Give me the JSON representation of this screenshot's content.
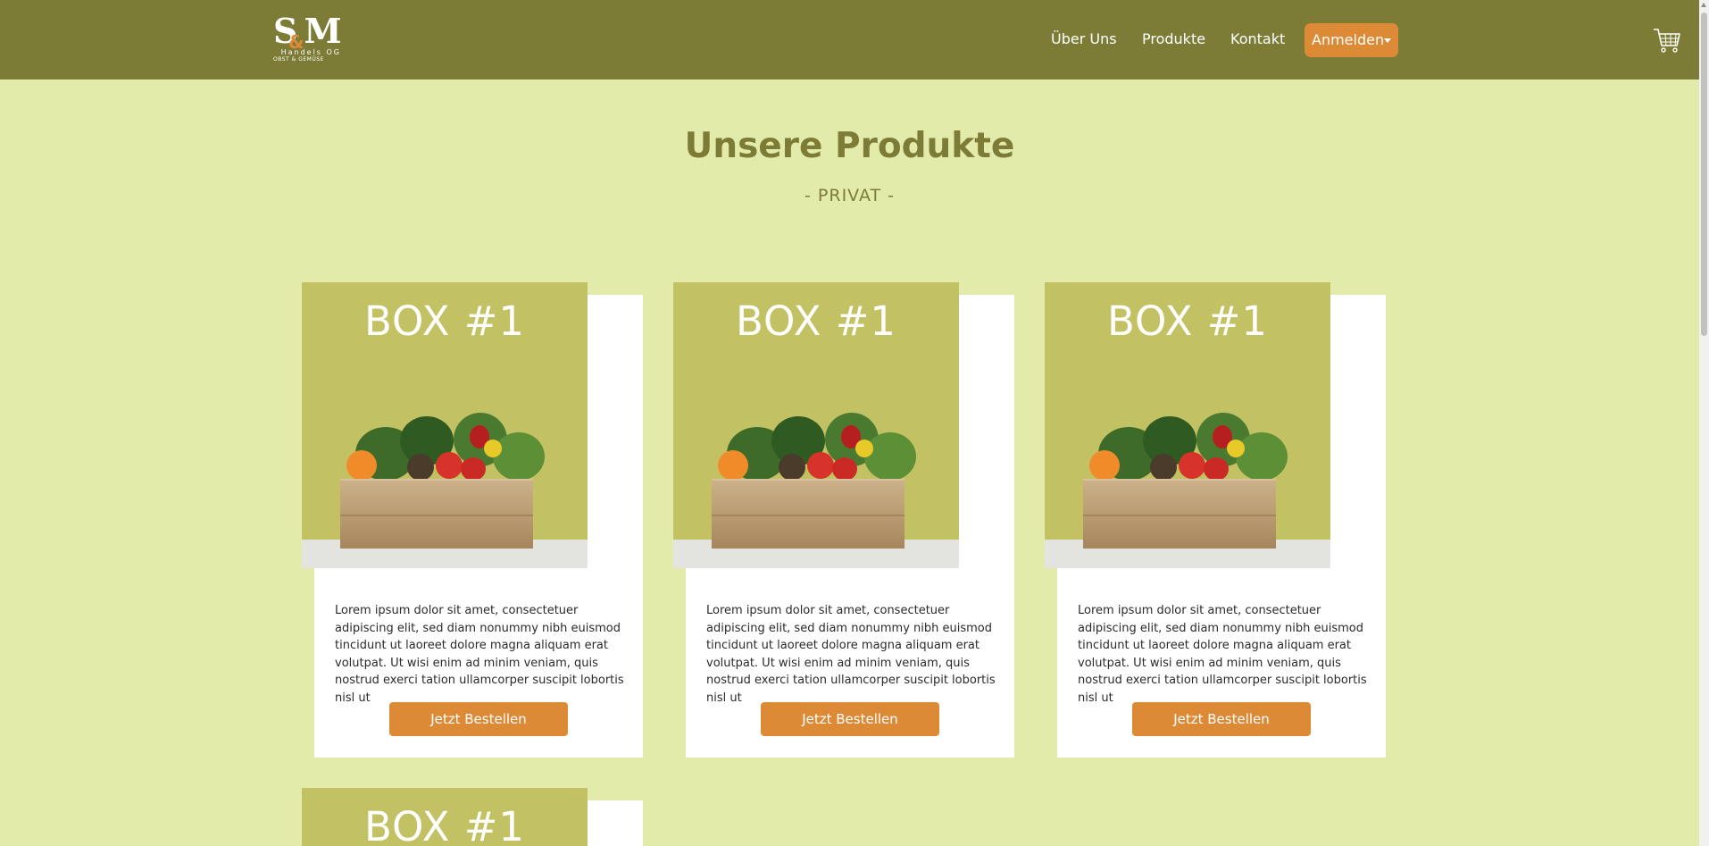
{
  "brand": {
    "logo_mark": "S&M",
    "logo_line1": "Handels OG",
    "logo_line2": "OBST & GEMÜSE"
  },
  "nav": {
    "items": [
      {
        "label": "Über Uns"
      },
      {
        "label": "Produkte"
      },
      {
        "label": "Kontakt"
      }
    ],
    "login_label": "Anmelden",
    "cart_icon": "shopping-cart-icon"
  },
  "page": {
    "title": "Unsere Produkte",
    "subtitle": "- PRIVAT -"
  },
  "products": [
    {
      "image_title": "BOX #1",
      "description": "Lorem ipsum dolor sit amet, consectetuer adipiscing elit, sed diam nonummy nibh euismod tincidunt ut laoreet dolore magna aliquam erat volutpat. Ut wisi enim ad minim veniam, quis nostrud exerci tation ullamcorper suscipit lobortis nisl ut",
      "button_label": "Jetzt Bestellen"
    },
    {
      "image_title": "BOX #1",
      "description": "Lorem ipsum dolor sit amet, consectetuer adipiscing elit, sed diam nonummy nibh euismod tincidunt ut laoreet dolore magna aliquam erat volutpat. Ut wisi enim ad minim veniam, quis nostrud exerci tation ullamcorper suscipit lobortis nisl ut",
      "button_label": "Jetzt Bestellen"
    },
    {
      "image_title": "BOX #1",
      "description": "Lorem ipsum dolor sit amet, consectetuer adipiscing elit, sed diam nonummy nibh euismod tincidunt ut laoreet dolore magna aliquam erat volutpat. Ut wisi enim ad minim veniam, quis nostrud exerci tation ullamcorper suscipit lobortis nisl ut",
      "button_label": "Jetzt Bestellen"
    },
    {
      "image_title": "BOX #1"
    }
  ],
  "colors": {
    "navbar": "#7c7c37",
    "page_background": "#e2eba9",
    "accent": "#dd8a37",
    "image_background": "#c2c164"
  }
}
